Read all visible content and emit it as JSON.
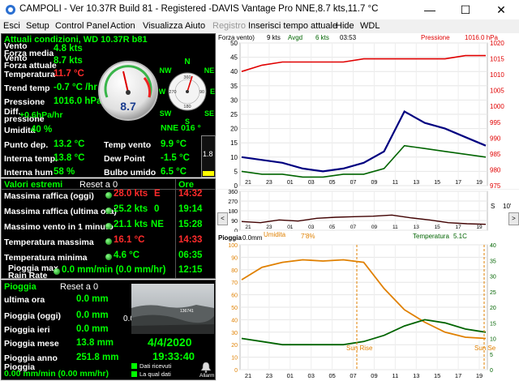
{
  "window": {
    "title": "CAMPOLI - Ver 10.37R Build 81 - Registered  -DAVIS Vantage Pro NNE,8.7 kts,11.7 °C",
    "min": "—",
    "max": "☐",
    "close": "✕"
  },
  "menu": [
    "Esci",
    "Setup",
    "Control Panel",
    "Action",
    "Visualizza",
    "Aiuto",
    "Registro",
    "Inserisci tempo attuale",
    "Hide",
    "WDL"
  ],
  "current": {
    "header": "Attuali condizioni, WD 10.37R b81",
    "rows": [
      {
        "label": "Vento\nForza media",
        "value": "4.8 kts"
      },
      {
        "label": "Vento\nForza attuale",
        "value": "8.7 kts"
      },
      {
        "label": "Temperatura",
        "value": "11.7 °C"
      },
      {
        "label": "Trend temp",
        "value": "-0.7 °C /hr"
      },
      {
        "label": "Pressione",
        "value": "1016.0 hPa"
      },
      {
        "label": "Diff.\npressione",
        "value": "+0.6hPa/hr"
      },
      {
        "label": "Umidita",
        "value": "40 %"
      }
    ],
    "bottom": [
      {
        "label": "Punto dep.",
        "value": "13.2 °C",
        "label2": "Temp vento",
        "value2": "9.9 °C"
      },
      {
        "label": "Interna temp.",
        "value": "13.8 °C",
        "label2": "Dew Point",
        "value2": "-1.5 °C"
      },
      {
        "label": "Interna hum",
        "value": "58 %",
        "label2": "Bulbo umido",
        "value2": "6.5 °C"
      }
    ],
    "gauge_speed": "8.7",
    "compass": {
      "N": "N",
      "NE": "NE",
      "E": "E",
      "SE": "SE",
      "S": "S",
      "SW": "SW",
      "W": "W",
      "NW": "NW",
      "ticks": [
        "360",
        "90",
        "180",
        "270"
      ]
    },
    "wind_dir": "NNE  016 °",
    "bar_value": "1.8"
  },
  "extremes": {
    "header": "Valori estremi",
    "reset": "Reset a 0",
    "ore_header": "Ore",
    "rows": [
      {
        "label": "Massima raffica (oggi)",
        "value": "28.0 kts",
        "dir": "E",
        "time": "14:32",
        "red": true
      },
      {
        "label": "Massima raffica (ultima ora)",
        "value": "25.2 kts",
        "dir": "0",
        "time": "19:14",
        "red": false
      },
      {
        "label": "Massimo vento in 1 minuto",
        "value": "21.1 kts",
        "dir": "NE",
        "time": "15:28",
        "red": false
      },
      {
        "label": "Temperatura massima",
        "value": "16.1 °C",
        "dir": "",
        "time": "14:33",
        "red": true
      },
      {
        "label": "Temperatura minima",
        "value": "4.6 °C",
        "dir": "",
        "time": "06:35",
        "red": false
      },
      {
        "label": "Pioggia max\nRain Rate",
        "value": "0.0 mm/min (0.0 mm/hr)",
        "dir": "",
        "time": "12:15",
        "red": false
      }
    ]
  },
  "rain": {
    "header": "Pioggia",
    "reset": "Reset a 0",
    "rows": [
      {
        "label": "ultima ora",
        "value": "0.0 mm"
      },
      {
        "label": "Pioggia (oggi)",
        "value": "0.0 mm"
      },
      {
        "label": "Pioggia ieri",
        "value": "0.0 mm"
      },
      {
        "label": "Pioggia mese",
        "value": "13.8 mm"
      },
      {
        "label": "Pioggia anno",
        "value": "251.8 mm"
      }
    ],
    "rate_label": "Pioggia",
    "rate": "0.00 mm/min (0.00 mm/hr)",
    "side": "0.0",
    "date": "4/4/2020",
    "time": "19:33:40",
    "legend1": "Dati ricevuti",
    "legend2": "La qual dati",
    "allarm": "Allarm",
    "cam_num": "136741"
  },
  "graphs": {
    "wind_legend": {
      "a": "Forza vento)",
      "b": "9 kts",
      "c": "Avgd",
      "d": "6 kts",
      "e": "03:53",
      "f": "Pressione",
      "g": "1016.0 hPa"
    },
    "hum_legend": {
      "a": "Umidita",
      "b": "7'8%",
      "c": "Temperatura",
      "d": "5.1C"
    },
    "rain_legend": {
      "a": "Pioggia",
      "b": "0.0mm"
    },
    "sunrise": "Sun Rise",
    "sunset": "Sun Se",
    "nav": {
      "left": "<",
      "right": ">",
      "s": "S",
      "z": "10'"
    }
  },
  "chart_data": [
    {
      "type": "line",
      "title": "",
      "x_ticks": [
        "21",
        "23",
        "01",
        "03",
        "05",
        "07",
        "09",
        "11",
        "13",
        "15",
        "17",
        "19"
      ],
      "y_ticks_left": [
        "0",
        "5",
        "10",
        "15",
        "20",
        "25",
        "30",
        "35",
        "40",
        "45",
        "50"
      ],
      "y_ticks_right": [
        "975",
        "980",
        "985",
        "990",
        "995",
        "1000",
        "1005",
        "1010",
        "1015",
        "1020"
      ],
      "ylim_left": [
        0,
        50
      ],
      "ylim_right": [
        975,
        1020
      ],
      "series": [
        {
          "name": "Forza vento",
          "color": "#000080",
          "axis": "left",
          "values": [
            10,
            9,
            8,
            6,
            5,
            6,
            8,
            12,
            26,
            22,
            20,
            17,
            14
          ]
        },
        {
          "name": "Avgd",
          "color": "#006400",
          "axis": "left",
          "values": [
            5,
            4,
            4,
            3,
            3,
            4,
            4,
            6,
            14,
            13,
            12,
            11,
            10
          ]
        },
        {
          "name": "Pressione",
          "color": "#e00000",
          "axis": "right",
          "values": [
            1011,
            1013,
            1014,
            1014,
            1014,
            1014,
            1015,
            1015,
            1015,
            1015,
            1015,
            1016,
            1016
          ]
        }
      ]
    },
    {
      "type": "line",
      "x_ticks": [
        "21",
        "23",
        "01",
        "03",
        "05",
        "07",
        "09",
        "11",
        "13",
        "15",
        "17",
        "19"
      ],
      "y_ticks": [
        "0",
        "90",
        "180",
        "270",
        "360"
      ],
      "ylim": [
        0,
        360
      ],
      "series": [
        {
          "name": "Direzione",
          "color": "#400000",
          "values": [
            80,
            70,
            95,
            85,
            110,
            120,
            125,
            130,
            140,
            115,
            95,
            70,
            60,
            55
          ]
        }
      ]
    },
    {
      "type": "line",
      "x_ticks": [
        "21",
        "23",
        "01",
        "03",
        "05",
        "07",
        "09",
        "11",
        "13",
        "15",
        "17",
        "19"
      ],
      "y_ticks_left": [
        "0",
        "10",
        "20",
        "30",
        "40",
        "50",
        "60",
        "70",
        "80",
        "90",
        "100"
      ],
      "y_ticks_right": [
        "0",
        "5",
        "10",
        "15",
        "20",
        "25",
        "30",
        "35",
        "40"
      ],
      "ylim_left": [
        0,
        100
      ],
      "ylim_right": [
        0,
        40
      ],
      "series": [
        {
          "name": "Umidita",
          "color": "#e08000",
          "axis": "left",
          "values": [
            72,
            82,
            86,
            88,
            87,
            88,
            86,
            65,
            48,
            38,
            30,
            26,
            25
          ]
        },
        {
          "name": "Temperatura",
          "color": "#006400",
          "axis": "right",
          "values": [
            10,
            9,
            8,
            8,
            8,
            8,
            9,
            11,
            14,
            16,
            15,
            13,
            12
          ]
        }
      ]
    }
  ]
}
